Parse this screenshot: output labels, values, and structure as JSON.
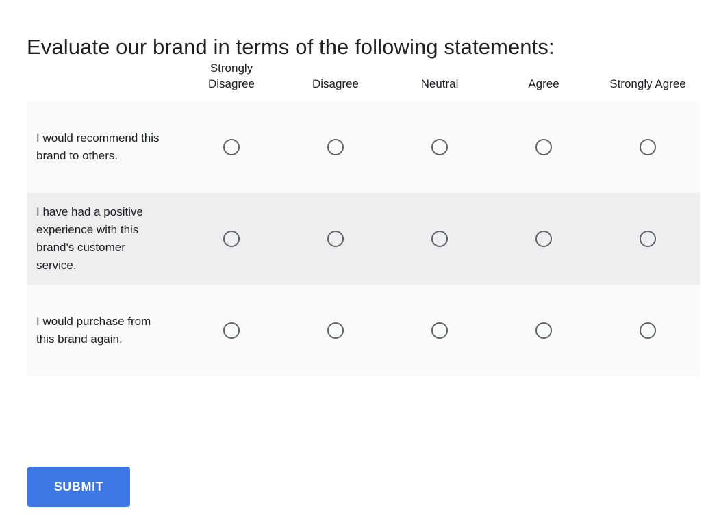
{
  "question": {
    "title": "Evaluate our brand in terms of the following statements:"
  },
  "grid": {
    "columns": [
      {
        "label": "Strongly Disagree"
      },
      {
        "label": "Disagree"
      },
      {
        "label": "Neutral"
      },
      {
        "label": "Agree"
      },
      {
        "label": "Strongly Agree"
      }
    ],
    "rows": [
      {
        "statement": "I would recommend this brand to others.",
        "selected": null
      },
      {
        "statement": "I have had a positive experience with this brand's customer service.",
        "selected": null
      },
      {
        "statement": "I would purchase from this brand again.",
        "selected": null
      }
    ]
  },
  "actions": {
    "submit_label": "SUBMIT"
  },
  "colors": {
    "submit_background": "#3d77e3",
    "submit_text": "#ffffff",
    "row_odd_background": "#fafafa",
    "row_even_background": "#eeeeee",
    "radio_border": "#5f6368",
    "text": "#202124"
  }
}
